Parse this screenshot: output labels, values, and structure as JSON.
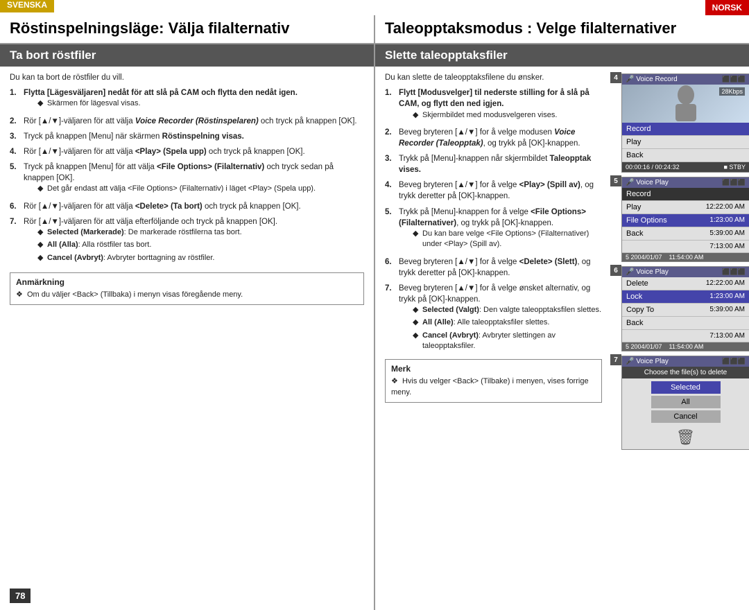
{
  "header": {
    "svenska_label": "SVENSKA",
    "norsk_label": "NORSK",
    "title_left": "Röstinspelningsläge: Välja filalternativ",
    "title_right": "Taleopptaksmodus : Velge filalternativer"
  },
  "section": {
    "heading_left": "Ta bort röstfiler",
    "heading_right": "Slette taleopptaksfiler"
  },
  "left": {
    "intro": "Du kan ta bort de röstfiler du vill.",
    "steps": [
      {
        "num": "1.",
        "text": "Flytta [Lägesväljaren] nedåt för att slå på CAM och flytta den nedåt igen.",
        "note": "◆ Skärmen för lägesval visas."
      },
      {
        "num": "2.",
        "text": "Rör [▲/▼]-väljaren för att välja Voice Recorder (Röstinspelaren) och tryck på knappen [OK]."
      },
      {
        "num": "3.",
        "text": "Tryck på knappen [Menu] när skärmen Röstinspelning visas."
      },
      {
        "num": "4.",
        "text": "Rör [▲/▼]-väljaren för att välja <Play> (Spela upp) och tryck på knappen [OK]."
      },
      {
        "num": "5.",
        "text": "Tryck på knappen [Menu] för att välja <File Options> (Filalternativ) och tryck sedan på knappen [OK].",
        "note": "◆ Det går endast att välja <File Options> (Filalternativ) i läget <Play> (Spela upp)."
      },
      {
        "num": "6.",
        "text": "Rör [▲/▼]-väljaren för att välja <Delete> (Ta bort) och tryck på knappen [OK]."
      },
      {
        "num": "7.",
        "text": "Rör [▲/▼]-väljaren för att välja efterföljande och tryck på knappen [OK].",
        "notes": [
          "◆ Selected (Markerade): De markerade röstfilerna tas bort.",
          "◆ All (Alla): Alla röstfiler tas bort.",
          "◆ Cancel (Avbryt): Avbryter borttagning av röstfiler."
        ]
      }
    ],
    "anmärkning": {
      "title": "Anmärkning",
      "text": "❖  Om du väljer <Back> (Tillbaka) i menyn visas föregående meny."
    }
  },
  "right": {
    "intro": "Du kan slette de taleopptaksfilene du ønsker.",
    "steps": [
      {
        "num": "1.",
        "text": "Flytt [Modusvelger] til nederste stilling for å slå på CAM, og flytt den ned igjen.",
        "note": "◆ Skjermbildet med modusvelgeren vises."
      },
      {
        "num": "2.",
        "text": "Beveg bryteren [▲/▼] for å velge modusen Voice Recorder (Taleopptak), og trykk på [OK]-knappen."
      },
      {
        "num": "3.",
        "text": "Trykk på [Menu]-knappen når skjermbildet Taleopptak vises."
      },
      {
        "num": "4.",
        "text": "Beveg bryteren [▲/▼] for å velge <Play> (Spill av), og trykk deretter på [OK]-knappen."
      },
      {
        "num": "5.",
        "text": "Trykk på [Menu]-knappen for å velge <File Options> (Filalternativer), og trykk på [OK]-knappen.",
        "note": "◆ Du kan bare velge <File Options> (Filalternativer) under <Play> (Spill av)."
      },
      {
        "num": "6.",
        "text": "Beveg bryteren [▲/▼] for å velge <Delete> (Slett), og trykk deretter på [OK]-knappen."
      },
      {
        "num": "7.",
        "text": "Beveg bryteren [▲/▼] for å velge ønsket alternativ, og trykk på [OK]-knappen.",
        "notes": [
          "◆ Selected (Valgt): Den valgte taleopptaksfilen slettes.",
          "◆ All (Alle): Alle taleopptaksfiler slettes.",
          "◆ Cancel (Avbryt): Avbryter slettingen av taleopptaksfiler."
        ]
      }
    ],
    "merk": {
      "title": "Merk",
      "text": "❖  Hvis du velger <Back> (Tilbake) i menyen, vises forrige meny."
    }
  },
  "screens": [
    {
      "num": "4",
      "header": "Voice Record",
      "items": [
        {
          "label": "Record",
          "selected": true
        },
        {
          "label": "Play",
          "selected": false
        },
        {
          "label": "Back",
          "selected": false
        }
      ],
      "has_image": true,
      "footer": "00:00:16 / 00:24:32",
      "kbps": "28Kbps",
      "stby": "STBY"
    },
    {
      "num": "5",
      "header": "Voice Play",
      "items": [
        {
          "label": "Record",
          "time": "",
          "selected": false
        },
        {
          "label": "Play",
          "time": "12:22:00 AM",
          "selected": false
        },
        {
          "label": "File Options",
          "time": "1:23:00 AM",
          "selected": true
        },
        {
          "label": "Back",
          "time": "5:39:00 AM",
          "selected": false
        }
      ],
      "date_row": "5 2004/01/07",
      "extra_time": "7:13:00 AM",
      "extra_time2": "11:54:00 AM"
    },
    {
      "num": "6",
      "header": "Voice Play",
      "items": [
        {
          "label": "Delete",
          "time": "12:22:00 AM",
          "selected": false
        },
        {
          "label": "Lock",
          "time": "1:23:00 AM",
          "selected": true
        },
        {
          "label": "Copy To",
          "time": "5:39:00 AM",
          "selected": false
        },
        {
          "label": "Back",
          "time": "",
          "selected": false
        }
      ],
      "date_row": "5 2004/01/07",
      "extra_time": "7:13:00 AM",
      "extra_time2": "11:54:00 AM"
    },
    {
      "num": "7",
      "header": "Voice Play",
      "popup_title": "Choose the file(s) to delete",
      "popup_options": [
        "Selected",
        "All",
        "Cancel"
      ],
      "popup_selected": "Selected"
    }
  ],
  "page_number": "78"
}
